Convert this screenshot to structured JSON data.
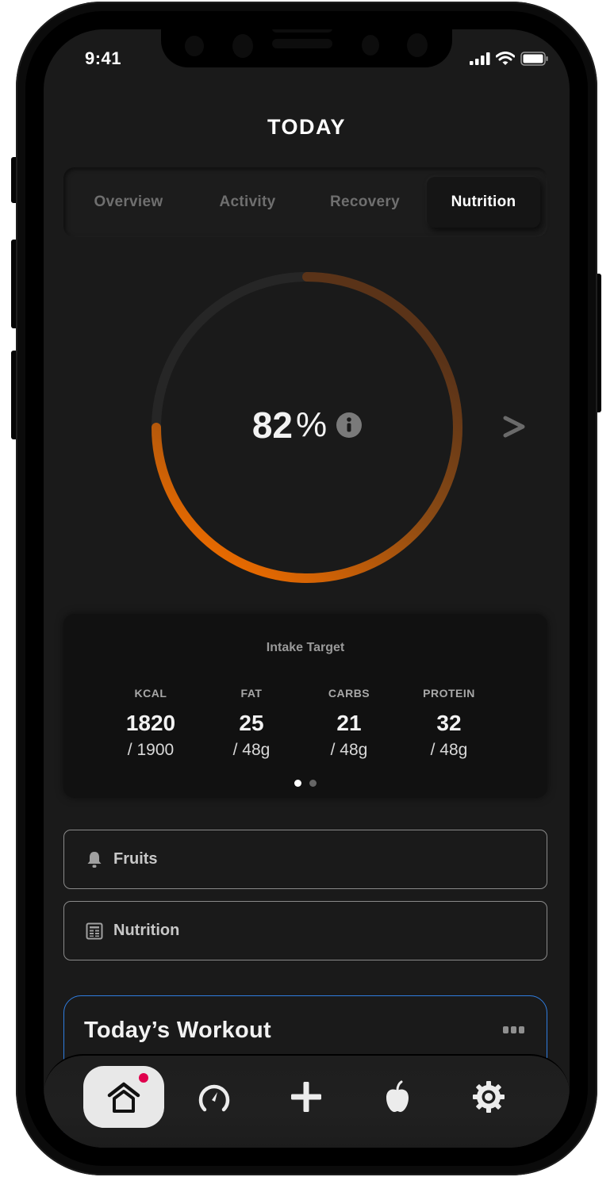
{
  "status_bar": {
    "time": "9:41",
    "icons": [
      "signal-icon",
      "wifi-icon",
      "battery-icon"
    ]
  },
  "header": {
    "title": "TODAY"
  },
  "tabs": [
    {
      "label": "Overview",
      "active": false
    },
    {
      "label": "Activity",
      "active": false
    },
    {
      "label": "Recovery",
      "active": false
    },
    {
      "label": "Nutrition",
      "active": true
    }
  ],
  "progress_ring": {
    "value_percent": 82,
    "display_number": "82",
    "display_sign": "%",
    "info_icon": "info-icon",
    "next_icon": "chevron-right-icon",
    "gradient_start": "#5a3318",
    "gradient_end": "#e86a00",
    "track_color": "#262626"
  },
  "intake": {
    "title": "Intake Target",
    "macros": [
      {
        "label": "KCAL",
        "value": "1820",
        "target": "/ 1900"
      },
      {
        "label": "FAT",
        "value": "25",
        "target": "/ 48g"
      },
      {
        "label": "CARBS",
        "value": "21",
        "target": "/ 48g"
      },
      {
        "label": "PROTEIN",
        "value": "32",
        "target": "/ 48g"
      }
    ],
    "pages": 2,
    "current_page": 1
  },
  "list_buttons": [
    {
      "label": "Fruits",
      "icon": "bell-icon"
    },
    {
      "label": "Nutrition",
      "icon": "calculator-icon"
    }
  ],
  "workout_card": {
    "title": "Today’s Workout",
    "more_icon": "more-icon",
    "accent": "#2f7de0"
  },
  "bottom_nav": [
    {
      "name": "home",
      "icon": "home-icon",
      "active": true,
      "badge": true,
      "badge_color": "#e0004d"
    },
    {
      "name": "dashboard",
      "icon": "speedometer-icon",
      "active": false
    },
    {
      "name": "add",
      "icon": "plus-icon",
      "active": false
    },
    {
      "name": "nutrition",
      "icon": "apple-icon",
      "active": false
    },
    {
      "name": "settings",
      "icon": "gear-icon",
      "active": false
    }
  ]
}
